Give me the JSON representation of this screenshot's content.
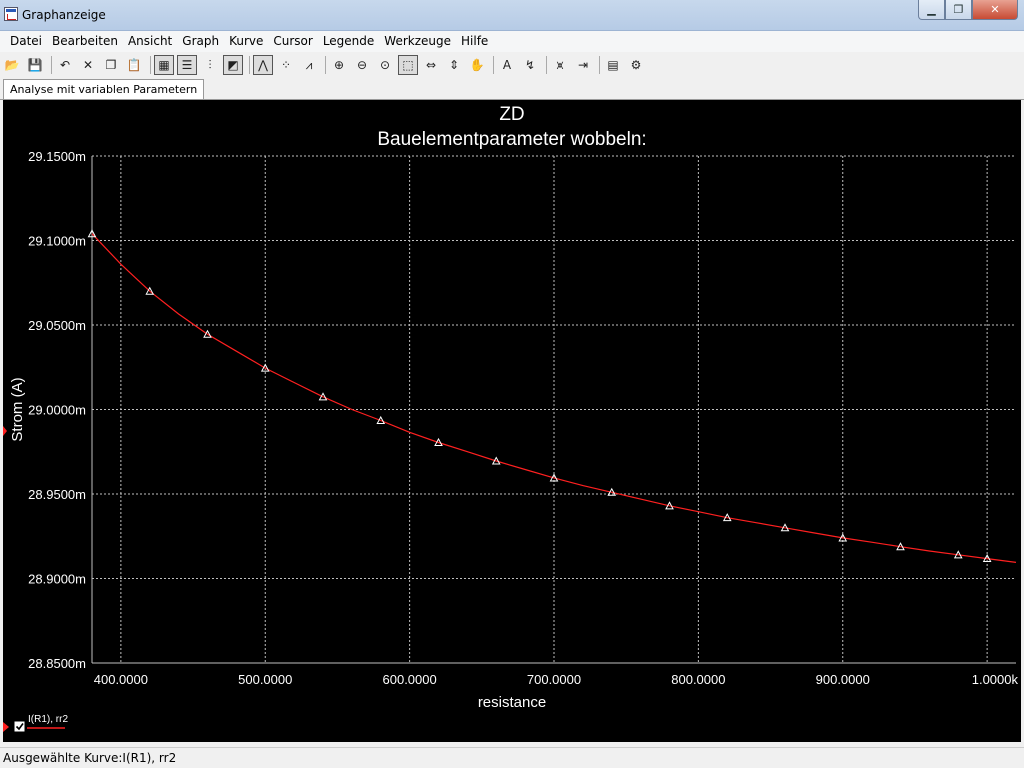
{
  "window": {
    "title": "Graphanzeige"
  },
  "menu": [
    "Datei",
    "Bearbeiten",
    "Ansicht",
    "Graph",
    "Kurve",
    "Cursor",
    "Legende",
    "Werkzeuge",
    "Hilfe"
  ],
  "toolbar": [
    {
      "name": "open-icon",
      "glyph": "📂"
    },
    {
      "name": "save-icon",
      "glyph": "💾"
    },
    {
      "sep": true
    },
    {
      "name": "undo-icon",
      "glyph": "↶"
    },
    {
      "name": "cut-icon",
      "glyph": "✕"
    },
    {
      "name": "copy-icon",
      "glyph": "❐"
    },
    {
      "name": "paste-icon",
      "glyph": "📋"
    },
    {
      "sep": true
    },
    {
      "name": "grid-icon",
      "glyph": "▦",
      "pressed": true
    },
    {
      "name": "legend-icon",
      "glyph": "☰",
      "pressed": true
    },
    {
      "name": "select-marks-icon",
      "glyph": "⫶"
    },
    {
      "name": "reverse-colors-icon",
      "glyph": "◩",
      "pressed": true
    },
    {
      "sep": true
    },
    {
      "name": "show-lines-icon",
      "glyph": "⋀",
      "pressed": true
    },
    {
      "name": "show-points-icon",
      "glyph": "⁘"
    },
    {
      "name": "show-lines-points-icon",
      "glyph": "⩘"
    },
    {
      "sep": true
    },
    {
      "name": "zoom-in-icon",
      "glyph": "⊕"
    },
    {
      "name": "zoom-out-icon",
      "glyph": "⊖"
    },
    {
      "name": "zoom-full-icon",
      "glyph": "⊙"
    },
    {
      "name": "zoom-area-icon",
      "glyph": "⬚",
      "pressed": true
    },
    {
      "name": "zoom-x-icon",
      "glyph": "⇔"
    },
    {
      "name": "zoom-y-icon",
      "glyph": "⇕"
    },
    {
      "name": "pan-hand-icon",
      "glyph": "✋"
    },
    {
      "sep": true
    },
    {
      "name": "text-tool-icon",
      "glyph": "A"
    },
    {
      "name": "probe-icon",
      "glyph": "↯"
    },
    {
      "sep": true
    },
    {
      "name": "cursor-icon",
      "glyph": "⩙"
    },
    {
      "name": "cursor-marker-icon",
      "glyph": "⇥"
    },
    {
      "sep": true
    },
    {
      "name": "export-icon",
      "glyph": "▤"
    },
    {
      "name": "properties-icon",
      "glyph": "⚙"
    }
  ],
  "tab": {
    "label": "Analyse mit variablen Parametern"
  },
  "status": {
    "text": "Ausgewählte Kurve:I(R1), rr2"
  },
  "colors": {
    "curve": "#ff2020",
    "grid": "#bfbfbf",
    "background": "#000000",
    "text": "#ffffff"
  },
  "chart_data": {
    "type": "line",
    "title": "ZD",
    "subtitle": "Bauelementparameter wobbeln:",
    "xlabel": "resistance",
    "ylabel": "Strom (A)",
    "xlim": [
      380,
      1020
    ],
    "ylim": [
      28.85,
      29.15
    ],
    "x_ticks": [
      400,
      500,
      600,
      700,
      800,
      900,
      1000
    ],
    "x_tick_labels": [
      "400.0000",
      "500.0000",
      "600.0000",
      "700.0000",
      "800.0000",
      "900.0000",
      "1.0000k"
    ],
    "y_ticks": [
      28.85,
      28.9,
      28.95,
      29.0,
      29.05,
      29.1,
      29.15
    ],
    "y_tick_labels": [
      "28.8500m",
      "28.9000m",
      "28.9500m",
      "29.0000m",
      "29.0500m",
      "29.1000m",
      "29.1500m"
    ],
    "grid": true,
    "series": [
      {
        "name": "I(R1), rr2",
        "marker": "triangle",
        "x": [
          380,
          400,
          420,
          440,
          460,
          480,
          500,
          520,
          540,
          560,
          580,
          600,
          620,
          640,
          660,
          680,
          700,
          720,
          740,
          760,
          780,
          800,
          820,
          840,
          860,
          880,
          900,
          920,
          940,
          960,
          980,
          1000,
          1020
        ],
        "y": [
          29.104,
          29.086,
          29.07,
          29.0565,
          29.0445,
          29.0345,
          29.0245,
          29.016,
          29.0075,
          29.0,
          28.9935,
          28.9865,
          28.9805,
          28.975,
          28.9695,
          28.9645,
          28.9595,
          28.955,
          28.951,
          28.947,
          28.943,
          28.9395,
          28.936,
          28.933,
          28.93,
          28.927,
          28.924,
          28.9215,
          28.9188,
          28.9163,
          28.914,
          28.9118,
          28.9095
        ],
        "marker_x": [
          380,
          420,
          460,
          500,
          540,
          580,
          620,
          660,
          700,
          740,
          780,
          820,
          860,
          900,
          940,
          980,
          1000
        ],
        "marker_y": [
          29.104,
          29.07,
          29.0445,
          29.0245,
          29.0075,
          28.9935,
          28.9805,
          28.9695,
          28.9595,
          28.951,
          28.943,
          28.936,
          28.93,
          28.924,
          28.9188,
          28.914,
          28.9118
        ]
      }
    ],
    "legend": {
      "position": "bottom-left",
      "entries": [
        "I(R1), rr2"
      ]
    }
  }
}
